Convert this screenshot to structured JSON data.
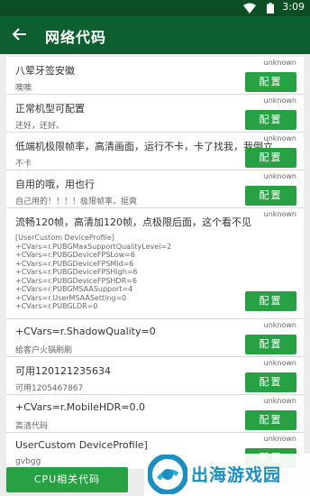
{
  "status_bar": {
    "time": "3:09"
  },
  "app_bar": {
    "title": "网络代码"
  },
  "items": [
    {
      "title": "八荤牙签安徽",
      "desc": "噢噢",
      "status": "unknown",
      "button": "配置"
    },
    {
      "title": "正常机型可配置",
      "desc": "还好，还好。",
      "status": "unknown",
      "button": "配置"
    },
    {
      "title": "低端机极限帧率，高清画面，运行不卡，卡了找我，我倒立吃屎",
      "desc": "不卡",
      "status": "unknown",
      "button": "配置"
    },
    {
      "title": "自用的哦，用也行",
      "desc": "自己用的！！！！极限帧率，挺爽",
      "status": "unknown",
      "button": "配置"
    },
    {
      "title": "流畅120帧，高清加120帧，点极限后面，这个看不见",
      "desc": "[UserCustom DeviceProfile]\n+CVars=r.PUBGMaxSupportQualityLevel=2\n+CVars=r.PUBGDeviceFPSLow=6\n+CVars=r.PUBGDeviceFPSMid=6\n+CVars=r.PUBGDeviceFPSHigh=6\n+CVars=r.PUBGDeviceFPSHDR=6\n+CVars=r.PUBGMSAASupport=4\n+CVars=r.UserMSAASetting=0\n+CVars=r.PUBGLDR=0",
      "status": "unknown",
      "button": "配置"
    },
    {
      "title": "+CVars=r.ShadowQuality=0",
      "desc": "给客户火锅刷刷",
      "status": "unknown",
      "button": "配置"
    },
    {
      "title": "可用120121235634",
      "desc": "可用1205467867",
      "status": "unknown",
      "button": "配置"
    },
    {
      "title": "+CVars=r.MobileHDR=0.0",
      "desc": "高清代码",
      "status": "unknown",
      "button": "配置"
    },
    {
      "title": "UserCustom DeviceProfile]",
      "desc": "gvbgg",
      "status": "unknown",
      "button": "配置"
    }
  ],
  "bottom": {
    "cpu_button": "CPU相关代码"
  },
  "watermark": {
    "text": "出海游戏园"
  },
  "colors": {
    "status_bar": "#0b4e24",
    "app_bar": "#0e5f2f",
    "button": "#27a143",
    "watermark": "#1c8fc0"
  }
}
